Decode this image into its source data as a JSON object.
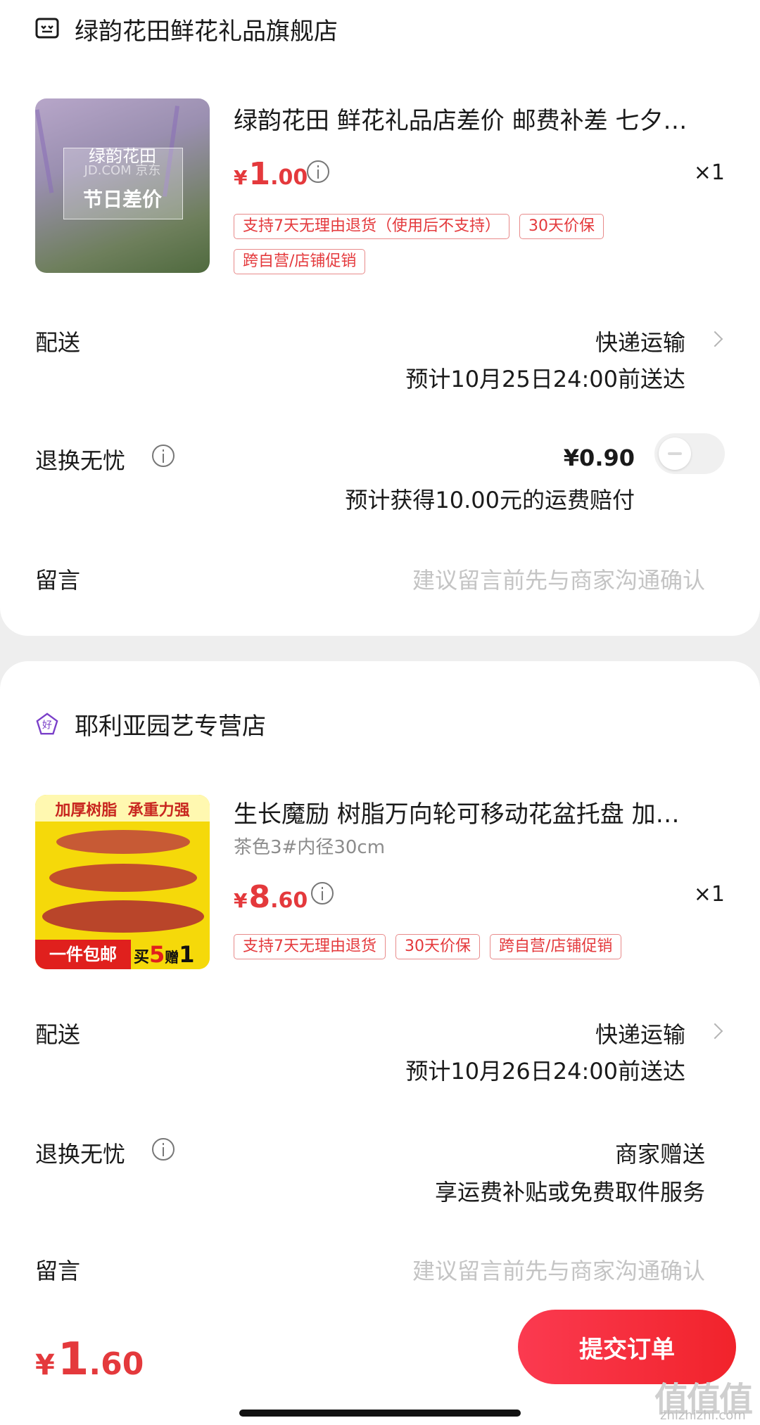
{
  "store1": {
    "name": "绿韵花田鲜花礼品旗舰店",
    "product": {
      "title": "绿韵花田 鲜花礼品店差价 邮费补差 七夕…",
      "thumb_text_line1": "绿韵花田",
      "thumb_text_line2": "JD.COM 京东",
      "thumb_text_line3": "节日差价",
      "price_symbol": "¥",
      "price_int": "1",
      "price_dec": ".00",
      "qty": "×1",
      "tags": [
        "支持7天无理由退货（使用后不支持）",
        "30天价保",
        "跨自营/店铺促销"
      ]
    },
    "delivery": {
      "label": "配送",
      "method": "快递运输",
      "eta": "预计10月25日24:00前送达"
    },
    "returns": {
      "label": "退换无忧",
      "price": "¥0.90",
      "desc": "预计获得10.00元的运费赔付",
      "toggle_on": false
    },
    "message": {
      "label": "留言",
      "placeholder": "建议留言前先与商家沟通确认"
    }
  },
  "store2": {
    "name": "耶利亚园艺专营店",
    "badge_char": "好",
    "product": {
      "title": "生长魔励 树脂万向轮可移动花盆托盘 加…",
      "spec": "茶色3#内径30cm",
      "thumb_top": "加厚树脂  承重力强",
      "thumb_bottom_left": "一件包邮",
      "thumb_bottom_right_a": "买",
      "thumb_bottom_right_b": "5",
      "thumb_bottom_right_c": "赠",
      "thumb_bottom_right_d": "1",
      "price_symbol": "¥",
      "price_int": "8",
      "price_dec": ".60",
      "qty": "×1",
      "tags": [
        "支持7天无理由退货",
        "30天价保",
        "跨自营/店铺促销"
      ]
    },
    "delivery": {
      "label": "配送",
      "method": "快递运输",
      "eta": "预计10月26日24:00前送达"
    },
    "returns": {
      "label": "退换无忧",
      "value": "商家赠送",
      "desc": "享运费补贴或免费取件服务"
    },
    "message": {
      "label": "留言",
      "placeholder": "建议留言前先与商家沟通确认"
    }
  },
  "footer": {
    "total_symbol": "¥",
    "total_int": "1",
    "total_dec": ".60",
    "submit_label": "提交订单",
    "watermark": "值值值",
    "watermark_url": "zhizhizhi.com"
  },
  "colors": {
    "accent": "#e4393c",
    "button": "#f1232b",
    "tag_border": "#e88a8a"
  }
}
